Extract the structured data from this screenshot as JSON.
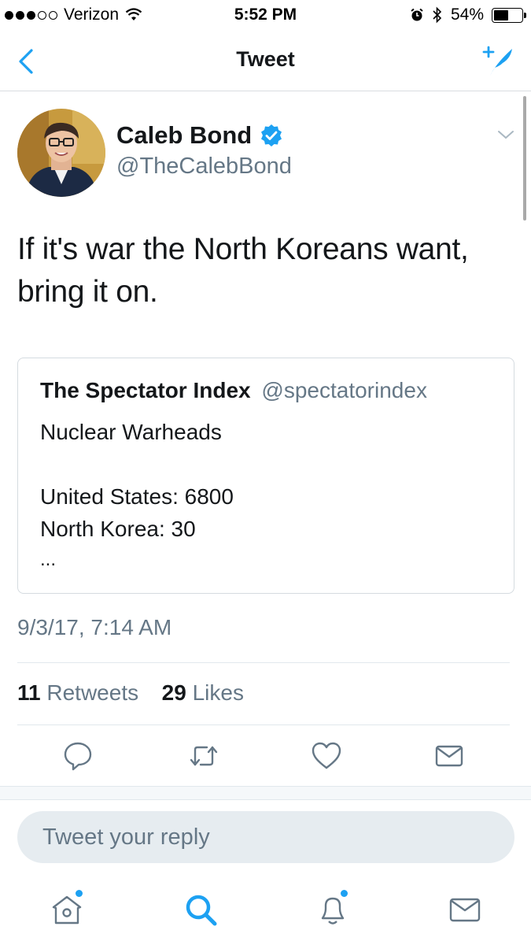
{
  "status_bar": {
    "carrier": "Verizon",
    "time": "5:52 PM",
    "battery_percent": "54%",
    "battery_level": 0.54,
    "signal_bars_filled": 3,
    "signal_bars_total": 5
  },
  "nav": {
    "title": "Tweet",
    "back_icon": "chevron-left-icon",
    "compose_icon": "compose-tweet-icon"
  },
  "tweet": {
    "author_name": "Caleb Bond",
    "author_handle": "@TheCalebBond",
    "verified": true,
    "text_line1": "If it's war the North Koreans want,",
    "text_line2": "bring it on.",
    "timestamp": "9/3/17, 7:14 AM",
    "retweets_count": "11",
    "retweets_label": "Retweets",
    "likes_count": "29",
    "likes_label": "Likes"
  },
  "quoted_tweet": {
    "name": "The Spectator Index",
    "handle": "@spectatorindex",
    "line1": "Nuclear Warheads",
    "line2": "United States: 6800",
    "line3": "North Korea: 30",
    "line4": "..."
  },
  "actions": [
    "reply-icon",
    "retweet-icon",
    "like-icon",
    "direct-message-icon"
  ],
  "reply": {
    "placeholder": "Tweet your reply"
  },
  "tab_bar": [
    "home-icon",
    "search-icon",
    "notifications-icon",
    "messages-icon"
  ],
  "colors": {
    "accent": "#1da1f2",
    "secondary_text": "#657786",
    "primary_text": "#14171a",
    "divider": "#e1e8ed"
  }
}
